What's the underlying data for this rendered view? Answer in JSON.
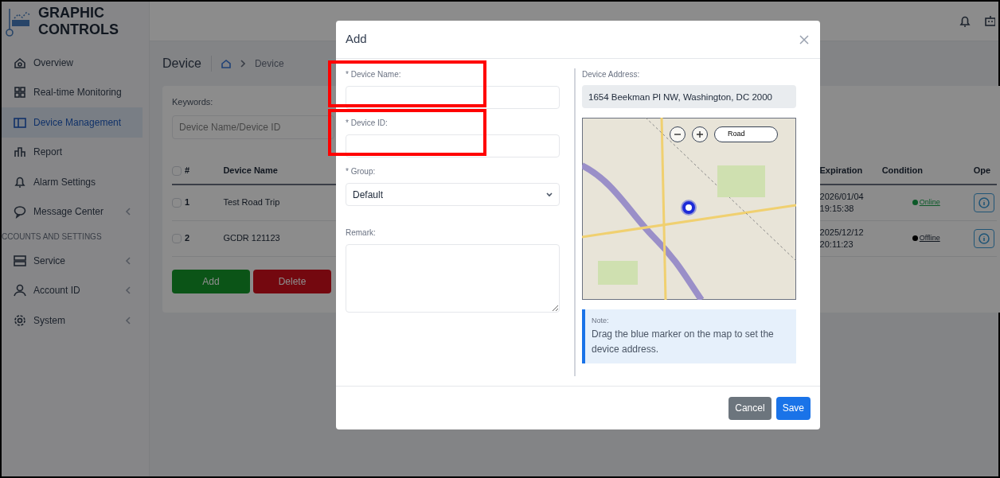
{
  "brand": {
    "lines": [
      "GRAPHIC",
      "CONTROLS"
    ]
  },
  "sidebar": {
    "items": [
      {
        "kind": "item",
        "label": "Overview",
        "selected": false,
        "submenu": false
      },
      {
        "kind": "item",
        "label": "Real-time Monitoring",
        "selected": false,
        "submenu": false
      },
      {
        "kind": "item",
        "label": "Device Management",
        "selected": true,
        "submenu": false
      },
      {
        "kind": "item",
        "label": "Report",
        "selected": false,
        "submenu": false
      },
      {
        "kind": "item",
        "label": "Alarm Settings",
        "selected": false,
        "submenu": false
      },
      {
        "kind": "item",
        "label": "Message Center",
        "selected": false,
        "submenu": true
      },
      {
        "kind": "section",
        "label": "CCOUNTS AND SETTINGS"
      },
      {
        "kind": "item",
        "label": "Service",
        "selected": false,
        "submenu": true
      },
      {
        "kind": "item",
        "label": "Account ID",
        "selected": false,
        "submenu": true
      },
      {
        "kind": "item",
        "label": "System",
        "selected": false,
        "submenu": true
      }
    ]
  },
  "page": {
    "title": "Device",
    "breadcrumb": "Device",
    "filter": {
      "label": "Keywords:",
      "placeholder": "Device Name/Device ID"
    },
    "table": {
      "all_checked": false,
      "columns": [
        "#",
        "Device Name",
        "Expiration",
        "Condition",
        "Ope"
      ],
      "rows": [
        {
          "index": "1",
          "name": "Test Road Trip",
          "expiration": [
            "2026/01/04",
            "19:15:38"
          ],
          "condition": "Online",
          "online": true,
          "checked": false
        },
        {
          "index": "2",
          "name": "GCDR 121123",
          "expiration": [
            "2025/12/12",
            "20:11:23"
          ],
          "condition": "Offline",
          "online": false,
          "checked": false
        }
      ]
    },
    "buttons": [
      {
        "label": "Add",
        "kind": "success"
      },
      {
        "label": "Delete",
        "kind": "danger"
      }
    ]
  },
  "modal": {
    "title": "Add",
    "fields": [
      {
        "kind": "input",
        "label": "* Device Name:",
        "highlighted": true
      },
      {
        "kind": "input",
        "label": "* Device ID:",
        "highlighted": true
      },
      {
        "kind": "select",
        "label": "* Group:",
        "value": "Default",
        "highlighted": false
      },
      {
        "kind": "textarea",
        "label": "Remark:",
        "highlighted": false
      }
    ],
    "address": {
      "label": "Device Address:",
      "value": "1654 Beekman Pl NW, Washington, DC 2000"
    },
    "map": {
      "style_button": "Road"
    },
    "note": {
      "title": "Note:",
      "text": "Drag the blue marker on the map to set the device address."
    },
    "buttons": [
      {
        "label": "Cancel",
        "kind": "secondary"
      },
      {
        "label": "Save",
        "kind": "primary"
      }
    ]
  }
}
